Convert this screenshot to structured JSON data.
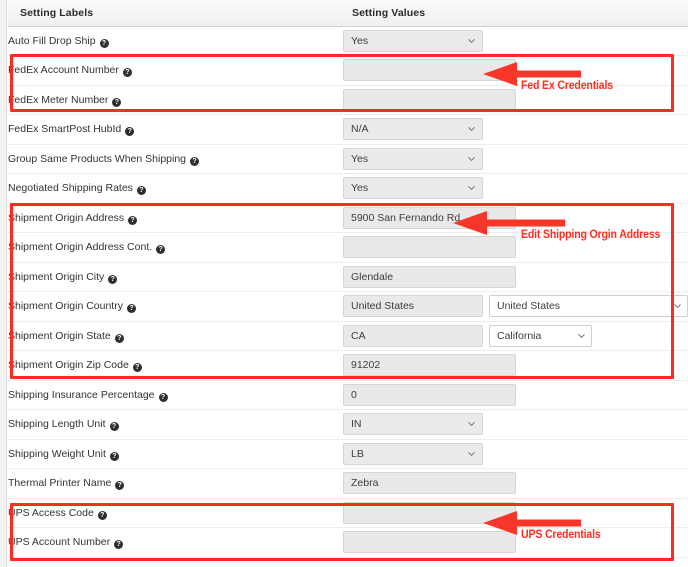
{
  "table": {
    "headers": {
      "labels": "Setting Labels",
      "values": "Setting Values"
    },
    "help_glyph": "?",
    "rows": [
      {
        "label": "Auto Fill Drop Ship",
        "control": "select-gray",
        "value": "Yes"
      },
      {
        "label": "FedEx Account Number",
        "control": "text",
        "value": ""
      },
      {
        "label": "FedEx Meter Number",
        "control": "text",
        "value": ""
      },
      {
        "label": "FedEx SmartPost HubId",
        "control": "select-gray",
        "value": "N/A"
      },
      {
        "label": "Group Same Products When Shipping",
        "control": "select-gray",
        "value": "Yes"
      },
      {
        "label": "Negotiated Shipping Rates",
        "control": "select-gray",
        "value": "Yes"
      },
      {
        "label": "Shipment Origin Address",
        "control": "text",
        "value": "5900 San Fernando Rd"
      },
      {
        "label": "Shipment Origin Address Cont.",
        "control": "text",
        "value": ""
      },
      {
        "label": "Shipment Origin City",
        "control": "text",
        "value": "Glendale"
      },
      {
        "label": "Shipment Origin Country",
        "control": "text-select-country",
        "value": "United States",
        "select_value": "United States"
      },
      {
        "label": "Shipment Origin State",
        "control": "text-select-state",
        "value": "CA",
        "select_value": "California"
      },
      {
        "label": "Shipment Origin Zip Code",
        "control": "text",
        "value": "91202"
      },
      {
        "label": "Shipping Insurance Percentage",
        "control": "text",
        "value": "0"
      },
      {
        "label": "Shipping Length Unit",
        "control": "select-gray",
        "value": "IN"
      },
      {
        "label": "Shipping Weight Unit",
        "control": "select-gray",
        "value": "LB"
      },
      {
        "label": "Thermal Printer Name",
        "control": "text",
        "value": "Zebra"
      },
      {
        "label": "UPS Access Code",
        "control": "text",
        "value": ""
      },
      {
        "label": "UPS Account Number",
        "control": "text",
        "value": ""
      }
    ]
  },
  "annotations": {
    "accent_color": "#fc2d20",
    "items": [
      {
        "text": "Fed Ex Credentials"
      },
      {
        "text": "Edit Shipping Orgin Address"
      },
      {
        "text": "UPS Credentials"
      }
    ]
  }
}
